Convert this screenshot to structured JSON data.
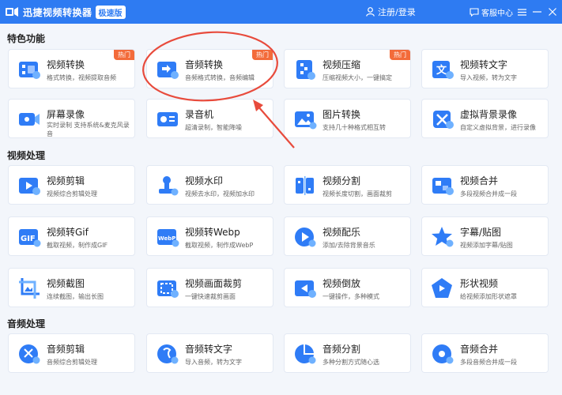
{
  "titlebar": {
    "app_title": "迅捷视频转换器",
    "edition_badge": "极速版",
    "login_label": "注册/登录",
    "service_label": "客服中心",
    "accent_color": "#2e7bf2"
  },
  "sections": {
    "special": "特色功能",
    "video": "视频处理",
    "audio": "音频处理"
  },
  "hot_label": "热门",
  "special_items": [
    {
      "name": "视频转换",
      "desc": "格式转换，视频提取音频",
      "hot": true,
      "icon": "video-convert-icon"
    },
    {
      "name": "音频转换",
      "desc": "音频格式转换，音频编辑",
      "hot": true,
      "icon": "audio-convert-icon"
    },
    {
      "name": "视频压缩",
      "desc": "压缩视频大小，一键搞定",
      "hot": true,
      "icon": "video-compress-icon"
    },
    {
      "name": "视频转文字",
      "desc": "导入视频，转为文字",
      "hot": false,
      "icon": "video-to-text-icon"
    },
    {
      "name": "屏幕录像",
      "desc": "实时录制 支持系统&麦克风录音",
      "hot": false,
      "icon": "screen-record-icon"
    },
    {
      "name": "录音机",
      "desc": "超清录制，智能降噪",
      "hot": false,
      "icon": "recorder-icon"
    },
    {
      "name": "图片转换",
      "desc": "支持几十种格式相互转",
      "hot": false,
      "icon": "image-convert-icon"
    },
    {
      "name": "虚拟背景录像",
      "desc": "自定义虚拟背景，进行录像",
      "hot": false,
      "icon": "virtual-bg-icon"
    }
  ],
  "video_items": [
    {
      "name": "视频剪辑",
      "desc": "视频综合剪辑处理",
      "icon": "video-edit-icon"
    },
    {
      "name": "视频水印",
      "desc": "视频去水印，视频加水印",
      "icon": "watermark-icon"
    },
    {
      "name": "视频分割",
      "desc": "视频长度切割，画面裁剪",
      "icon": "video-split-icon"
    },
    {
      "name": "视频合并",
      "desc": "多段视频合并成一段",
      "icon": "video-merge-icon"
    },
    {
      "name": "视频转Gif",
      "desc": "截取视频，制作成GIF",
      "icon": "gif-icon"
    },
    {
      "name": "视频转Webp",
      "desc": "截取视频，制作成WebP",
      "icon": "webp-icon"
    },
    {
      "name": "视频配乐",
      "desc": "添加/去除背景音乐",
      "icon": "music-icon"
    },
    {
      "name": "字幕/贴图",
      "desc": "视频添加字幕/贴图",
      "icon": "star-icon"
    },
    {
      "name": "视频截图",
      "desc": "连续截图，输出长图",
      "icon": "screenshot-icon"
    },
    {
      "name": "视频画面裁剪",
      "desc": "一键快速裁剪画面",
      "icon": "crop-icon"
    },
    {
      "name": "视频倒放",
      "desc": "一键操作，多种模式",
      "icon": "reverse-icon"
    },
    {
      "name": "形状视频",
      "desc": "给视频添加形状遮罩",
      "icon": "shape-icon"
    }
  ],
  "audio_items": [
    {
      "name": "音频剪辑",
      "desc": "音频综合剪辑处理",
      "icon": "audio-edit-icon"
    },
    {
      "name": "音频转文字",
      "desc": "导入音频，转为文字",
      "icon": "audio-to-text-icon"
    },
    {
      "name": "音频分割",
      "desc": "多种分割方式随心选",
      "icon": "audio-split-icon"
    },
    {
      "name": "音频合并",
      "desc": "多段音频合并成一段",
      "icon": "audio-merge-icon"
    }
  ],
  "annotation_color": "#e84b3c"
}
